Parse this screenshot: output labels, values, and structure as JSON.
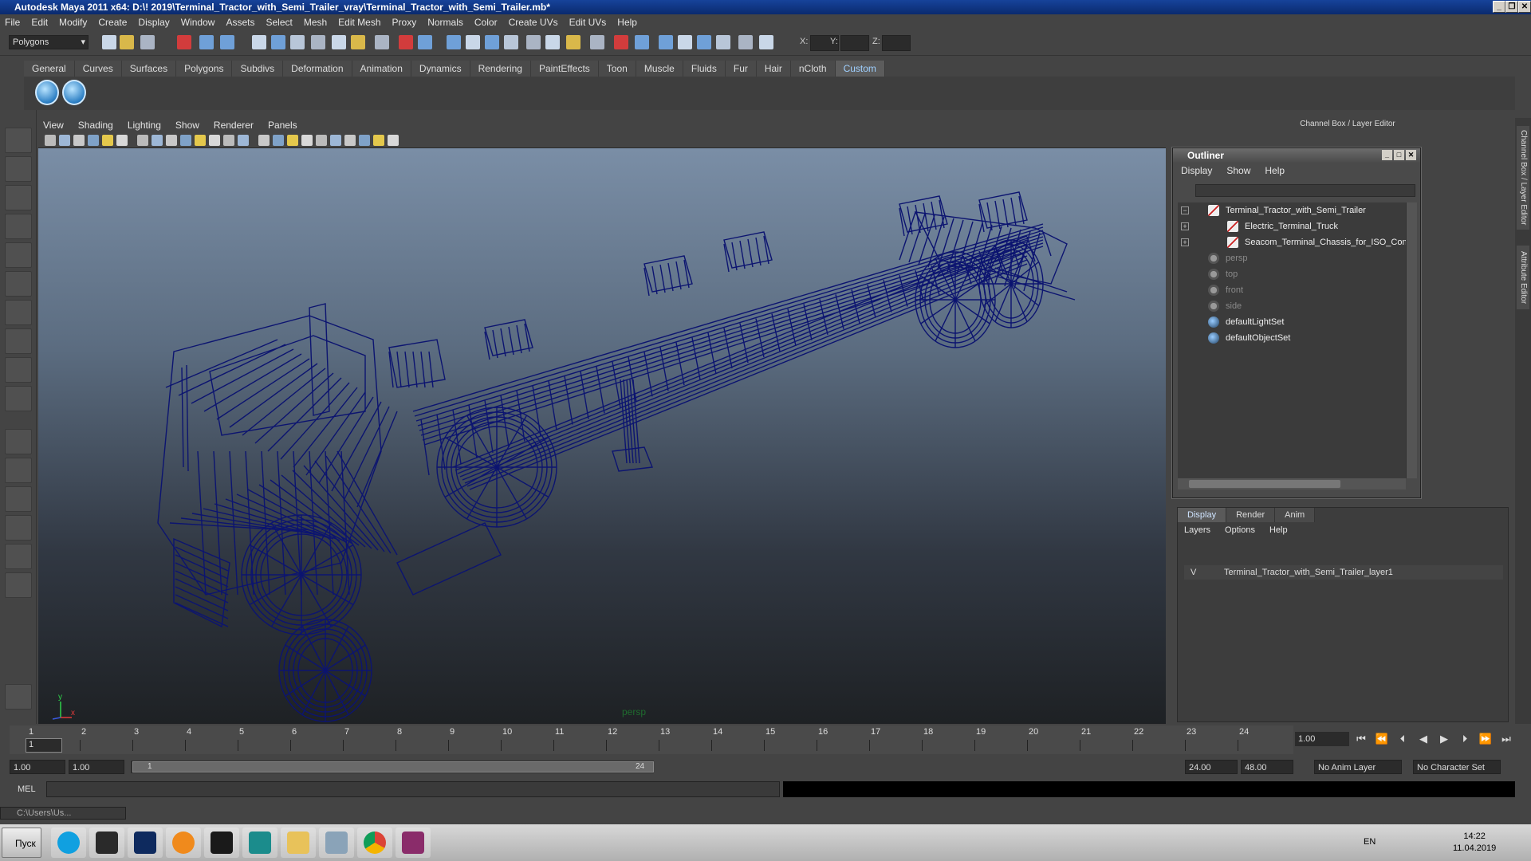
{
  "window": {
    "title": "Autodesk Maya 2011 x64: D:\\! 2019\\Terminal_Tractor_with_Semi_Trailer_vray\\Terminal_Tractor_with_Semi_Trailer.mb*"
  },
  "menubar": [
    "File",
    "Edit",
    "Modify",
    "Create",
    "Display",
    "Window",
    "Assets",
    "Select",
    "Mesh",
    "Edit Mesh",
    "Proxy",
    "Normals",
    "Color",
    "Create UVs",
    "Edit UVs",
    "Help"
  ],
  "toolbar": {
    "mode": "Polygons",
    "x_label": "X:",
    "y_label": "Y:",
    "z_label": "Z:"
  },
  "shelf": {
    "tabs": [
      "General",
      "Curves",
      "Surfaces",
      "Polygons",
      "Subdivs",
      "Deformation",
      "Animation",
      "Dynamics",
      "Rendering",
      "PaintEffects",
      "Toon",
      "Muscle",
      "Fluids",
      "Fur",
      "Hair",
      "nCloth",
      "Custom"
    ],
    "active": "Custom"
  },
  "viewport": {
    "menu": [
      "View",
      "Shading",
      "Lighting",
      "Show",
      "Renderer",
      "Panels"
    ],
    "camera_label": "persp",
    "wire_color": "#0c1470",
    "axis_x": "x",
    "axis_y": "y"
  },
  "channel_box": {
    "title": "Channel Box / Layer Editor"
  },
  "outliner": {
    "title": "Outliner",
    "menu": [
      "Display",
      "Show",
      "Help"
    ],
    "items": [
      {
        "label": "Terminal_Tractor_with_Semi_Trailer",
        "expand": "−",
        "dim": false,
        "icon": "transform-icon"
      },
      {
        "label": "Electric_Terminal_Truck",
        "expand": "+",
        "dim": false,
        "icon": "transform-icon"
      },
      {
        "label": "Seacom_Terminal_Chassis_for_ISO_Cont",
        "expand": "+",
        "dim": false,
        "icon": "transform-icon"
      },
      {
        "label": "persp",
        "expand": "",
        "dim": true,
        "icon": "camera-icon"
      },
      {
        "label": "top",
        "expand": "",
        "dim": true,
        "icon": "camera-icon"
      },
      {
        "label": "front",
        "expand": "",
        "dim": true,
        "icon": "camera-icon"
      },
      {
        "label": "side",
        "expand": "",
        "dim": true,
        "icon": "camera-icon"
      },
      {
        "label": "defaultLightSet",
        "expand": "",
        "dim": false,
        "icon": "set-icon"
      },
      {
        "label": "defaultObjectSet",
        "expand": "",
        "dim": false,
        "icon": "set-icon"
      }
    ]
  },
  "layer_editor": {
    "tabs": [
      "Display",
      "Render",
      "Anim"
    ],
    "active": "Display",
    "menu": [
      "Layers",
      "Options",
      "Help"
    ],
    "layer_visibility": "V",
    "layer_name": "Terminal_Tractor_with_Semi_Trailer_layer1"
  },
  "side_tabs": [
    "Channel Box / Layer Editor",
    "Attribute Editor"
  ],
  "timeline": {
    "frames": [
      "1",
      "2",
      "3",
      "4",
      "5",
      "6",
      "7",
      "8",
      "9",
      "10",
      "11",
      "12",
      "13",
      "14",
      "15",
      "16",
      "17",
      "18",
      "19",
      "20",
      "21",
      "22",
      "23",
      "24"
    ],
    "current_marker": "1",
    "current_frame": "1.00"
  },
  "range": {
    "start": "1.00",
    "anim_start": "1.00",
    "slider_start": "1",
    "slider_end": "24",
    "anim_end": "24.00",
    "end": "48.00",
    "anim_layer": "No Anim Layer",
    "character_set": "No Character Set"
  },
  "command": {
    "label": "MEL"
  },
  "minimized": {
    "label": "C:\\Users\\Us..."
  },
  "taskbar": {
    "start": "Пуск",
    "lang": "EN",
    "time": "14:22",
    "date": "11.04.2019"
  }
}
